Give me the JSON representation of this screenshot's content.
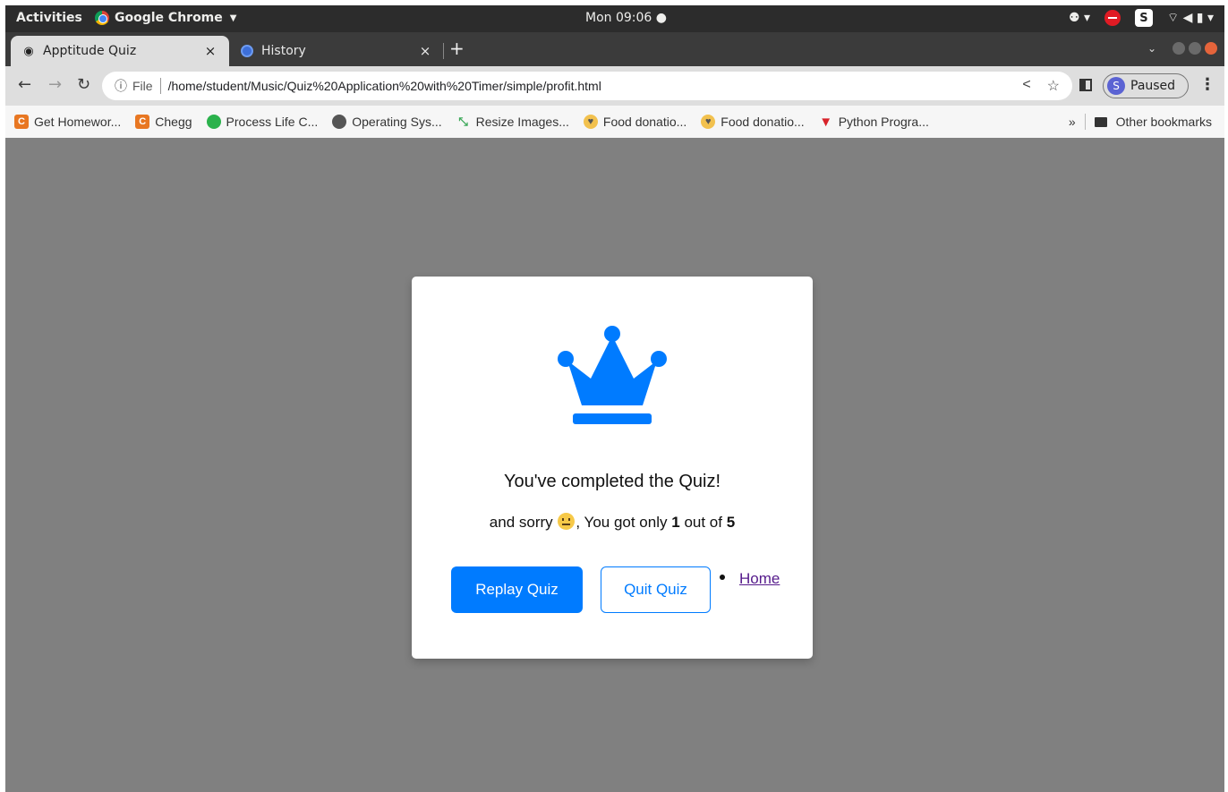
{
  "system_bar": {
    "activities": "Activities",
    "app_name": "Google Chrome",
    "clock": "Mon 09:06 ●",
    "tray_s": "S"
  },
  "tabs": [
    {
      "title": "Apptitude Quiz",
      "active": true,
      "icon": "globe-icon"
    },
    {
      "title": "History",
      "active": false,
      "icon": "history-icon"
    }
  ],
  "toolbar": {
    "file_label": "File",
    "url": "/home/student/Music/Quiz%20Application%20with%20Timer/simple/profit.html",
    "profile_initial": "S",
    "profile_status": "Paused"
  },
  "bookmarks": [
    {
      "label": "Get Homewor...",
      "icon": "chegg-icon",
      "glyph": "C"
    },
    {
      "label": "Chegg",
      "icon": "chegg-icon",
      "glyph": "C"
    },
    {
      "label": "Process Life C...",
      "icon": "leaf-icon",
      "glyph": "●"
    },
    {
      "label": "Operating Sys...",
      "icon": "globe-icon",
      "glyph": "◉"
    },
    {
      "label": "Resize Images...",
      "icon": "resize-icon",
      "glyph": "⤡"
    },
    {
      "label": "Food donatio...",
      "icon": "food-icon",
      "glyph": "♥"
    },
    {
      "label": "Food donatio...",
      "icon": "food-icon",
      "glyph": "♥"
    },
    {
      "label": "Python Progra...",
      "icon": "python-icon",
      "glyph": "▼"
    }
  ],
  "other_bookmarks": "Other bookmarks",
  "quiz": {
    "completed_text": "You've completed the Quiz!",
    "score_prefix": "and sorry",
    "score_mid": ", You got only",
    "score_value": "1",
    "score_out_of": "out of",
    "score_total": "5",
    "replay_label": "Replay Quiz",
    "quit_label": "Quit Quiz",
    "home_link": "Home",
    "accent_color": "#007bff"
  }
}
